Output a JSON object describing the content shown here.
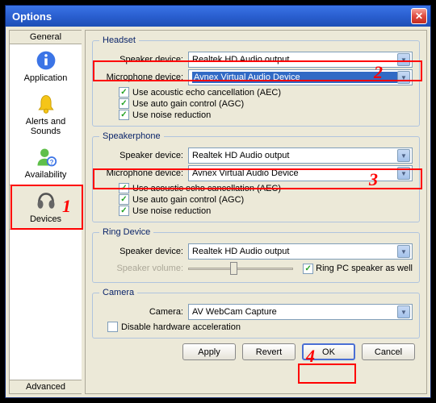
{
  "window": {
    "title": "Options"
  },
  "sidebar": {
    "generalTab": "General",
    "advancedTab": "Advanced",
    "items": [
      {
        "label": "Application"
      },
      {
        "label": "Alerts and Sounds"
      },
      {
        "label": "Availability"
      },
      {
        "label": "Devices"
      }
    ]
  },
  "headset": {
    "legend": "Headset",
    "speakerLabel": "Speaker device:",
    "speakerValue": "Realtek HD Audio output",
    "micLabel": "Microphone device:",
    "micValue": "Avnex Virtual Audio Device",
    "aec": "Use acoustic echo cancellation (AEC)",
    "agc": "Use auto gain control (AGC)",
    "nr": "Use noise reduction"
  },
  "speakerphone": {
    "legend": "Speakerphone",
    "speakerLabel": "Speaker device:",
    "speakerValue": "Realtek HD Audio output",
    "micLabel": "Microphone device:",
    "micValue": "Avnex Virtual Audio Device",
    "aec": "Use acoustic echo cancellation (AEC)",
    "agc": "Use auto gain control (AGC)",
    "nr": "Use noise reduction"
  },
  "ring": {
    "legend": "Ring Device",
    "speakerLabel": "Speaker device:",
    "speakerValue": "Realtek HD Audio output",
    "volumeLabel": "Speaker volume:",
    "ringPc": "Ring PC speaker as well"
  },
  "camera": {
    "legend": "Camera",
    "label": "Camera:",
    "value": "AV WebCam Capture",
    "disableAccel": "Disable hardware acceleration"
  },
  "buttons": {
    "apply": "Apply",
    "revert": "Revert",
    "ok": "OK",
    "cancel": "Cancel"
  },
  "annotations": {
    "n1": "1",
    "n2": "2",
    "n3": "3",
    "n4": "4"
  }
}
